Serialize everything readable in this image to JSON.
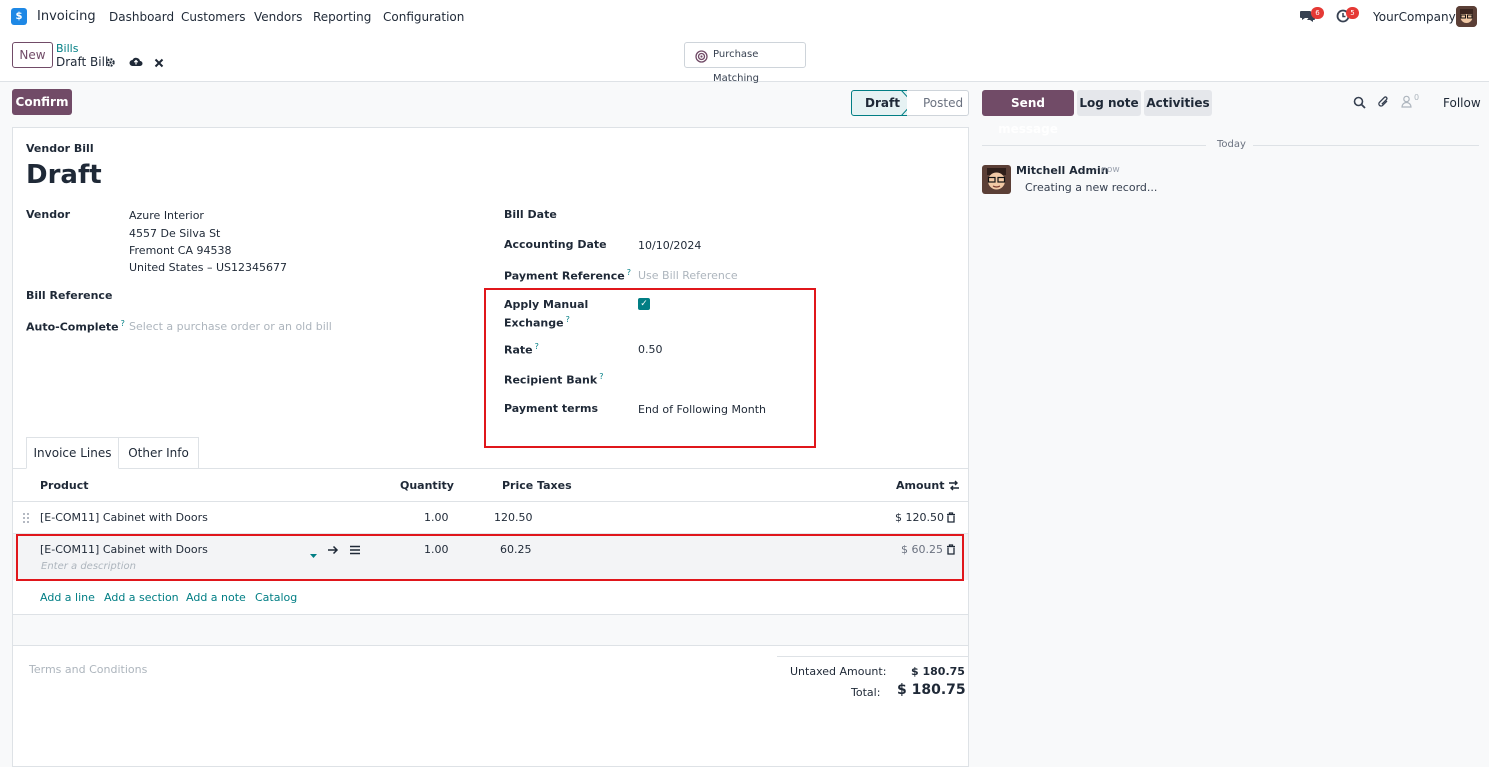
{
  "app": {
    "name": "Invoicing",
    "logo_letter": "$",
    "menu": [
      "Dashboard",
      "Customers",
      "Vendors",
      "Reporting",
      "Configuration"
    ],
    "messages_count": "6",
    "activities_count": "5",
    "company": "YourCompany"
  },
  "control": {
    "new_label": "New",
    "breadcrumb_parent": "Bills",
    "breadcrumb_current": "Draft Bill",
    "purchase_matching": "Purchase Matching"
  },
  "statusbar": {
    "confirm_label": "Confirm",
    "states": [
      "Draft",
      "Posted"
    ]
  },
  "form": {
    "doc_type": "Vendor Bill",
    "title": "Draft",
    "vendor_label": "Vendor",
    "vendor_lines": [
      "Azure Interior",
      "4557 De Silva St",
      "Fremont CA 94538",
      "United States – US12345677"
    ],
    "bill_reference_label": "Bill Reference",
    "autocomplete_label": "Auto-Complete",
    "autocomplete_placeholder": "Select a purchase order or an old bill",
    "bill_date_label": "Bill Date",
    "accounting_date_label": "Accounting Date",
    "accounting_date": "10/10/2024",
    "payment_reference_label": "Payment Reference",
    "payment_reference_placeholder": "Use Bill Reference",
    "manual_exchange_label_1": "Apply Manual",
    "manual_exchange_label_2": "Exchange",
    "manual_exchange_checked": true,
    "rate_label": "Rate",
    "rate": "0.50",
    "recipient_bank_label": "Recipient Bank",
    "payment_terms_label": "Payment terms",
    "payment_terms": "End of Following Month",
    "help_mark": "?"
  },
  "tabs": [
    "Invoice Lines",
    "Other Info"
  ],
  "lines": {
    "headers": {
      "product": "Product",
      "quantity": "Quantity",
      "price": "Price",
      "taxes": "Taxes",
      "amount": "Amount"
    },
    "rows": [
      {
        "product": "[E-COM11] Cabinet with Doors",
        "quantity": "1.00",
        "price": "120.50",
        "amount": "$ 120.50"
      },
      {
        "product": "[E-COM11] Cabinet with Doors",
        "quantity": "1.00",
        "price": "60.25",
        "amount": "$ 60.25",
        "description_placeholder": "Enter a description"
      }
    ],
    "actions": [
      "Add a line",
      "Add a section",
      "Add a note",
      "Catalog"
    ]
  },
  "totals": {
    "terms_placeholder": "Terms and Conditions",
    "untaxed_label": "Untaxed Amount:",
    "untaxed_value": "$ 180.75",
    "total_label": "Total:",
    "total_value": "$ 180.75"
  },
  "chatter": {
    "send_message": "Send message",
    "log_note": "Log note",
    "activities": "Activities",
    "followers_count": "0",
    "follow": "Follow",
    "date_separator": "Today",
    "message": {
      "author": "Mitchell Admin",
      "time": "- now",
      "body": "Creating a new record..."
    }
  },
  "colors": {
    "brand": "#714b67",
    "teal": "#017e84",
    "highlight": "#e0161b"
  }
}
